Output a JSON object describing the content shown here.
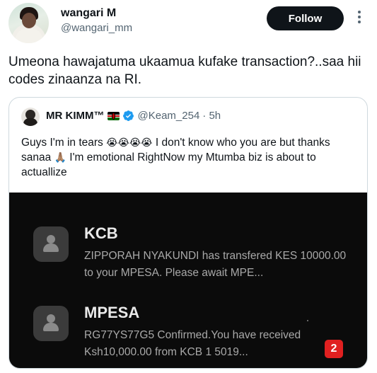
{
  "author": {
    "name": "wangari M",
    "handle": "@wangari_mm"
  },
  "follow_label": "Follow",
  "tweet_text": "Umeona hawajatuma ukaamua kufake transaction?..saa hii codes zinaanza na RI.",
  "quoted": {
    "name": "MR KIMM™",
    "handle": "@Keam_254",
    "time": "· 5h",
    "text_parts": {
      "p1": "Guys I'm in tears ",
      "tears_emoji": "😭😭😭😭",
      "p2": " I don't know who you are but thanks sanaa ",
      "pray_emoji": "🙏🏽",
      "p3": " I'm emotional RightNow my Mtumba biz is about to actuallize"
    },
    "image": {
      "notifications": [
        {
          "sender": "KCB",
          "message": "ZIPPORAH NYAKUNDI has transfered KES 10000.00 to your MPESA. Please await MPE..."
        },
        {
          "sender": "MPESA",
          "message": "RG77YS77G5 Confirmed.You have received Ksh10,000.00 from KCB 1 5019..."
        }
      ],
      "badge_count": "2"
    }
  },
  "colors": {
    "text": "#0f1419",
    "secondary": "#536471",
    "verified": "#1d9bf0",
    "border": "#cfd9de",
    "badge": "#e02020"
  },
  "icons": {
    "more": "more-icon",
    "verified": "verified-icon",
    "flag": "kenya-flag-icon",
    "contact": "contact-icon"
  }
}
